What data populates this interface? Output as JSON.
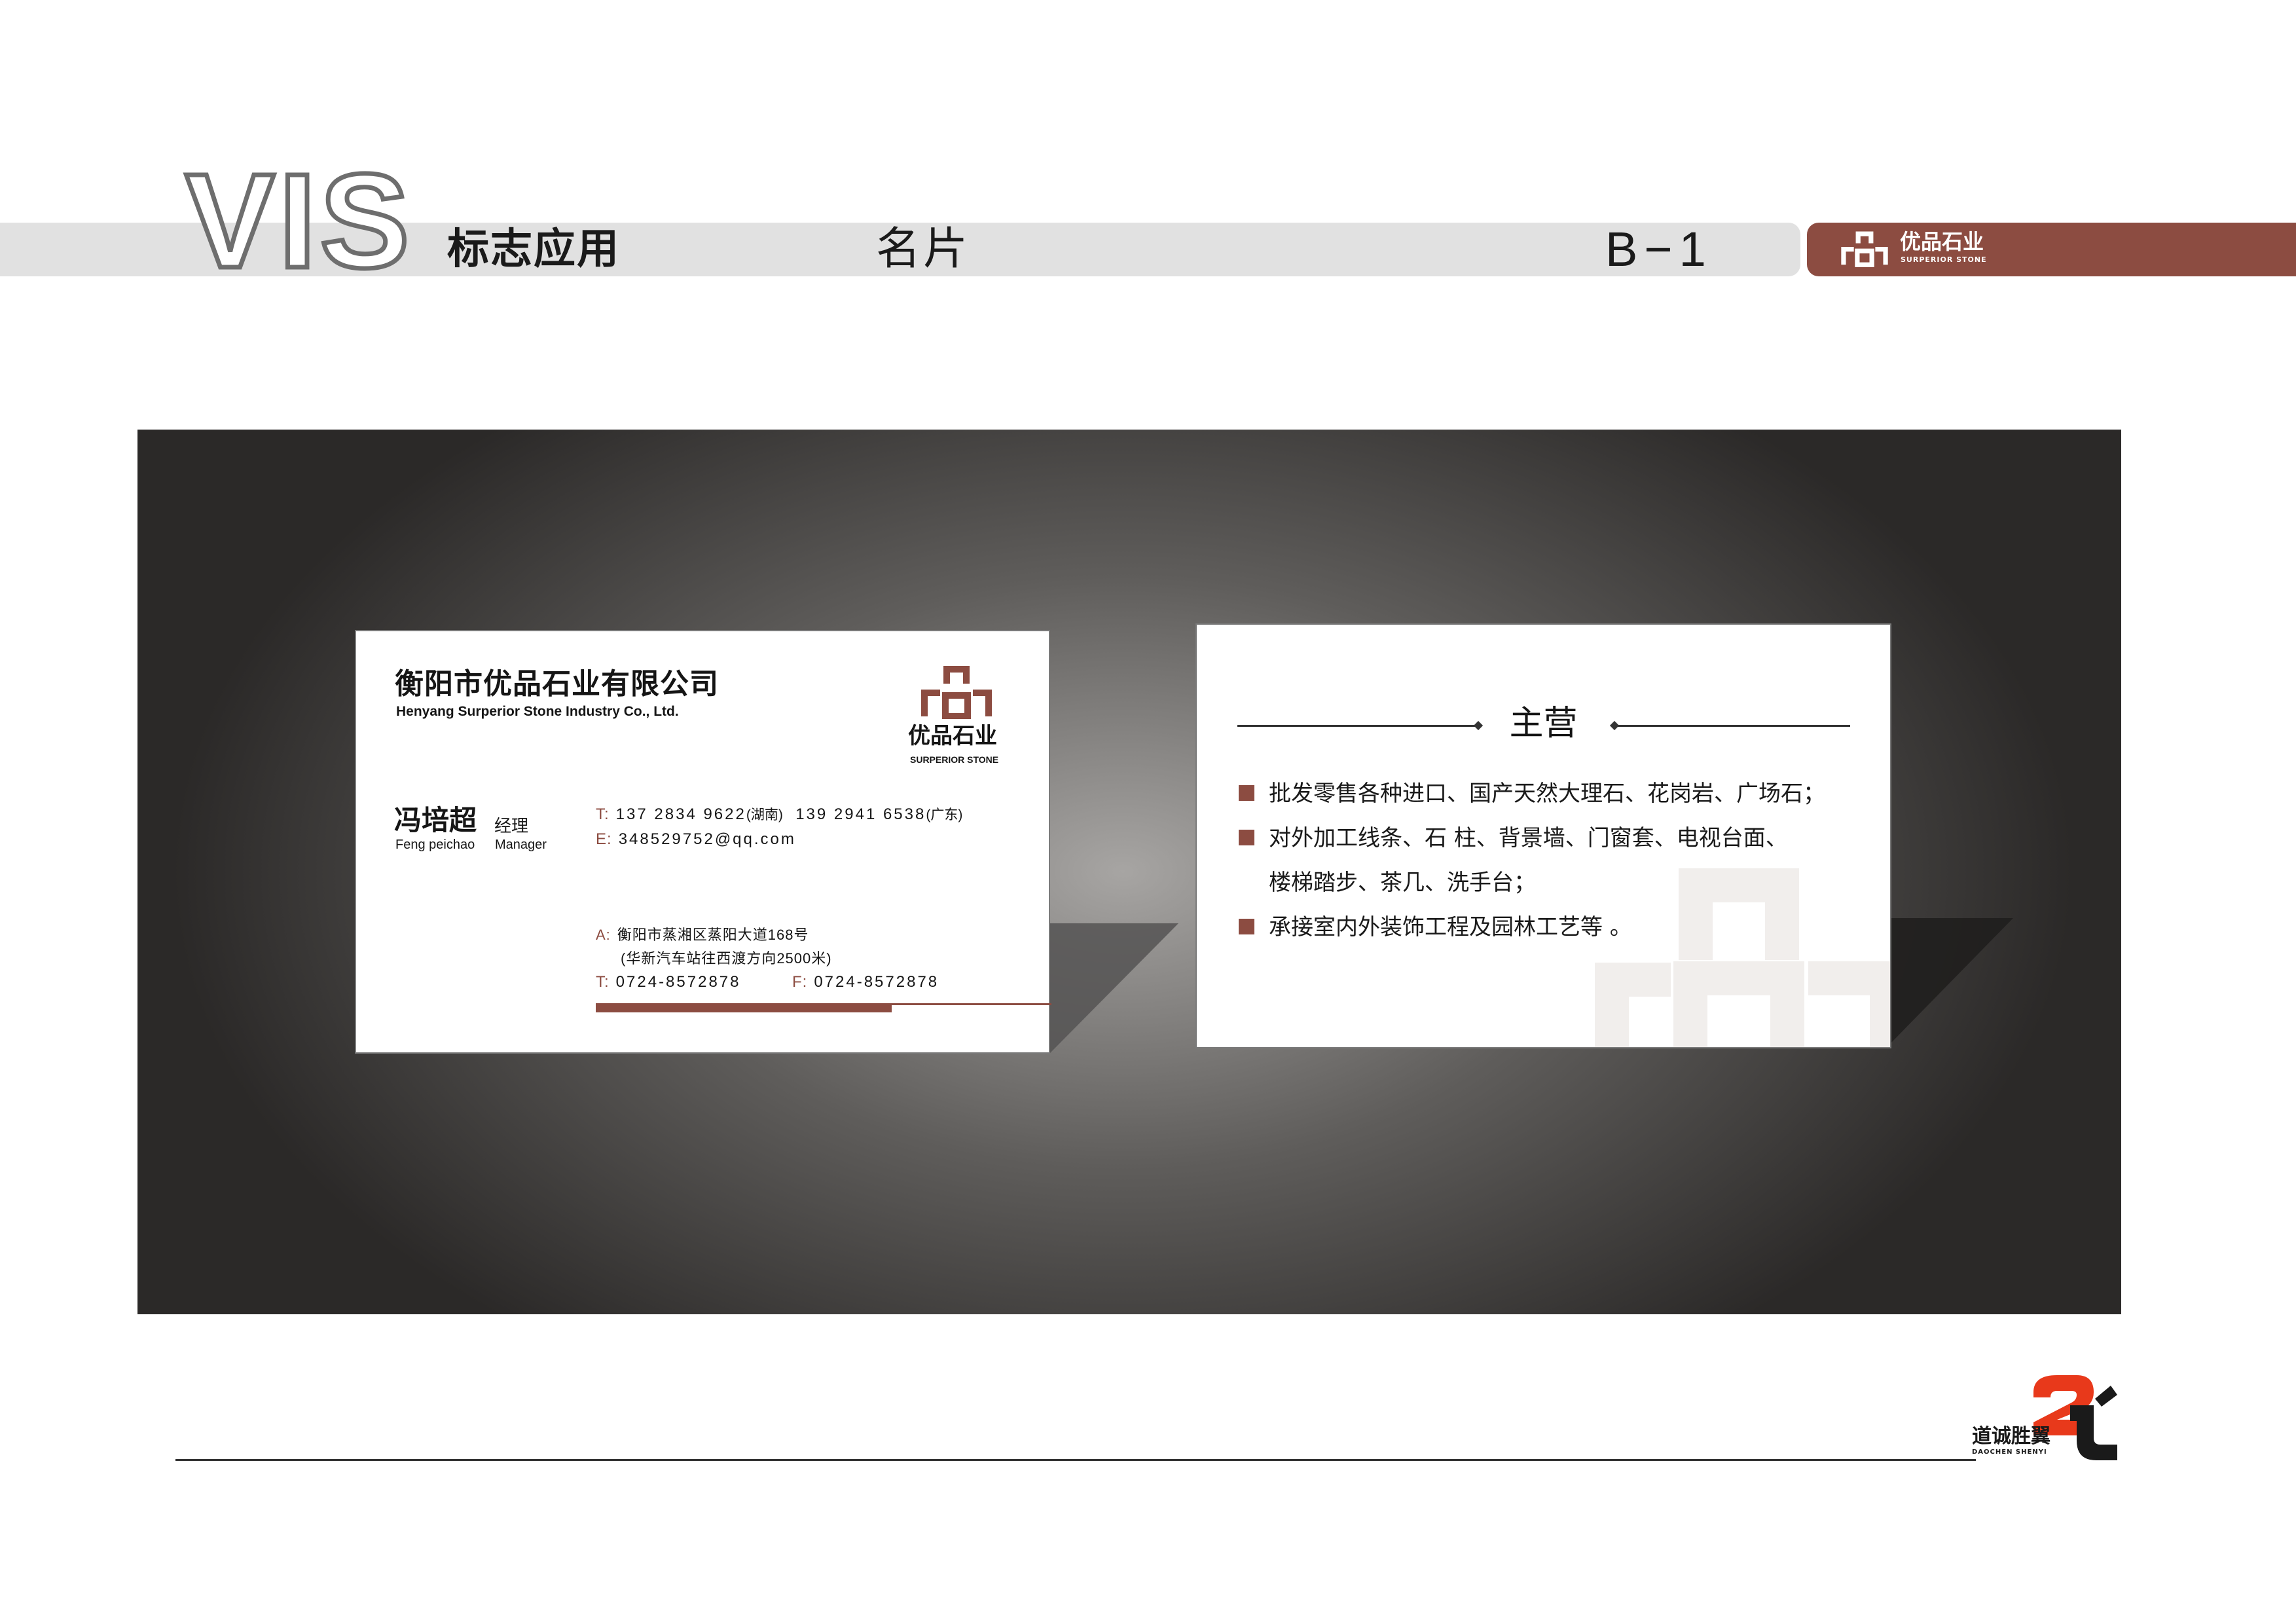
{
  "header": {
    "vis": "VIS",
    "section": "标志应用",
    "page_title": "名片",
    "page_code": "B−1",
    "brand": {
      "name": "优品石业",
      "name_en": "SURPERIOR STONE"
    }
  },
  "colors": {
    "accent": "#8c4c41",
    "header_band": "#e1e1e1",
    "text": "#151515"
  },
  "front_card": {
    "company_cn": "衡阳市优品石业有限公司",
    "company_en": "Henyang Surperior  Stone Industry Co., Ltd.",
    "logo_name": "优品石业",
    "logo_en": "SURPERIOR STONE",
    "person_name": "冯培超",
    "person_title": "经理",
    "person_name_en": "Feng peichao",
    "person_title_en": "Manager",
    "phone_label": "T:",
    "phone_1": "137 2834 9622",
    "phone_1_region": "(湖南)",
    "phone_2": "139 2941 6538",
    "phone_2_region": "(广东)",
    "email_label": "E:",
    "email": "348529752@qq.com",
    "address_label": "A:",
    "address": "衡阳市蒸湘区蒸阳大道168号",
    "address_note": "(华新汽车站往西渡方向2500米)",
    "tel_label": "T:",
    "tel": "0724-8572878",
    "fax_label": "F:",
    "fax": "0724-8572878"
  },
  "back_card": {
    "heading": "主营",
    "items": [
      "批发零售各种进口、国产天然大理石、花岗岩、广场石；",
      "对外加工线条、石 柱、背景墙、门窗套、电视台面、",
      "承接室内外装饰工程及园林工艺等 。"
    ],
    "item_2_continued": "楼梯踏步、茶几、洗手台；"
  },
  "footer": {
    "studio_cn": "道诚胜翼",
    "studio_en": "DAOCHEN SHENYI"
  }
}
